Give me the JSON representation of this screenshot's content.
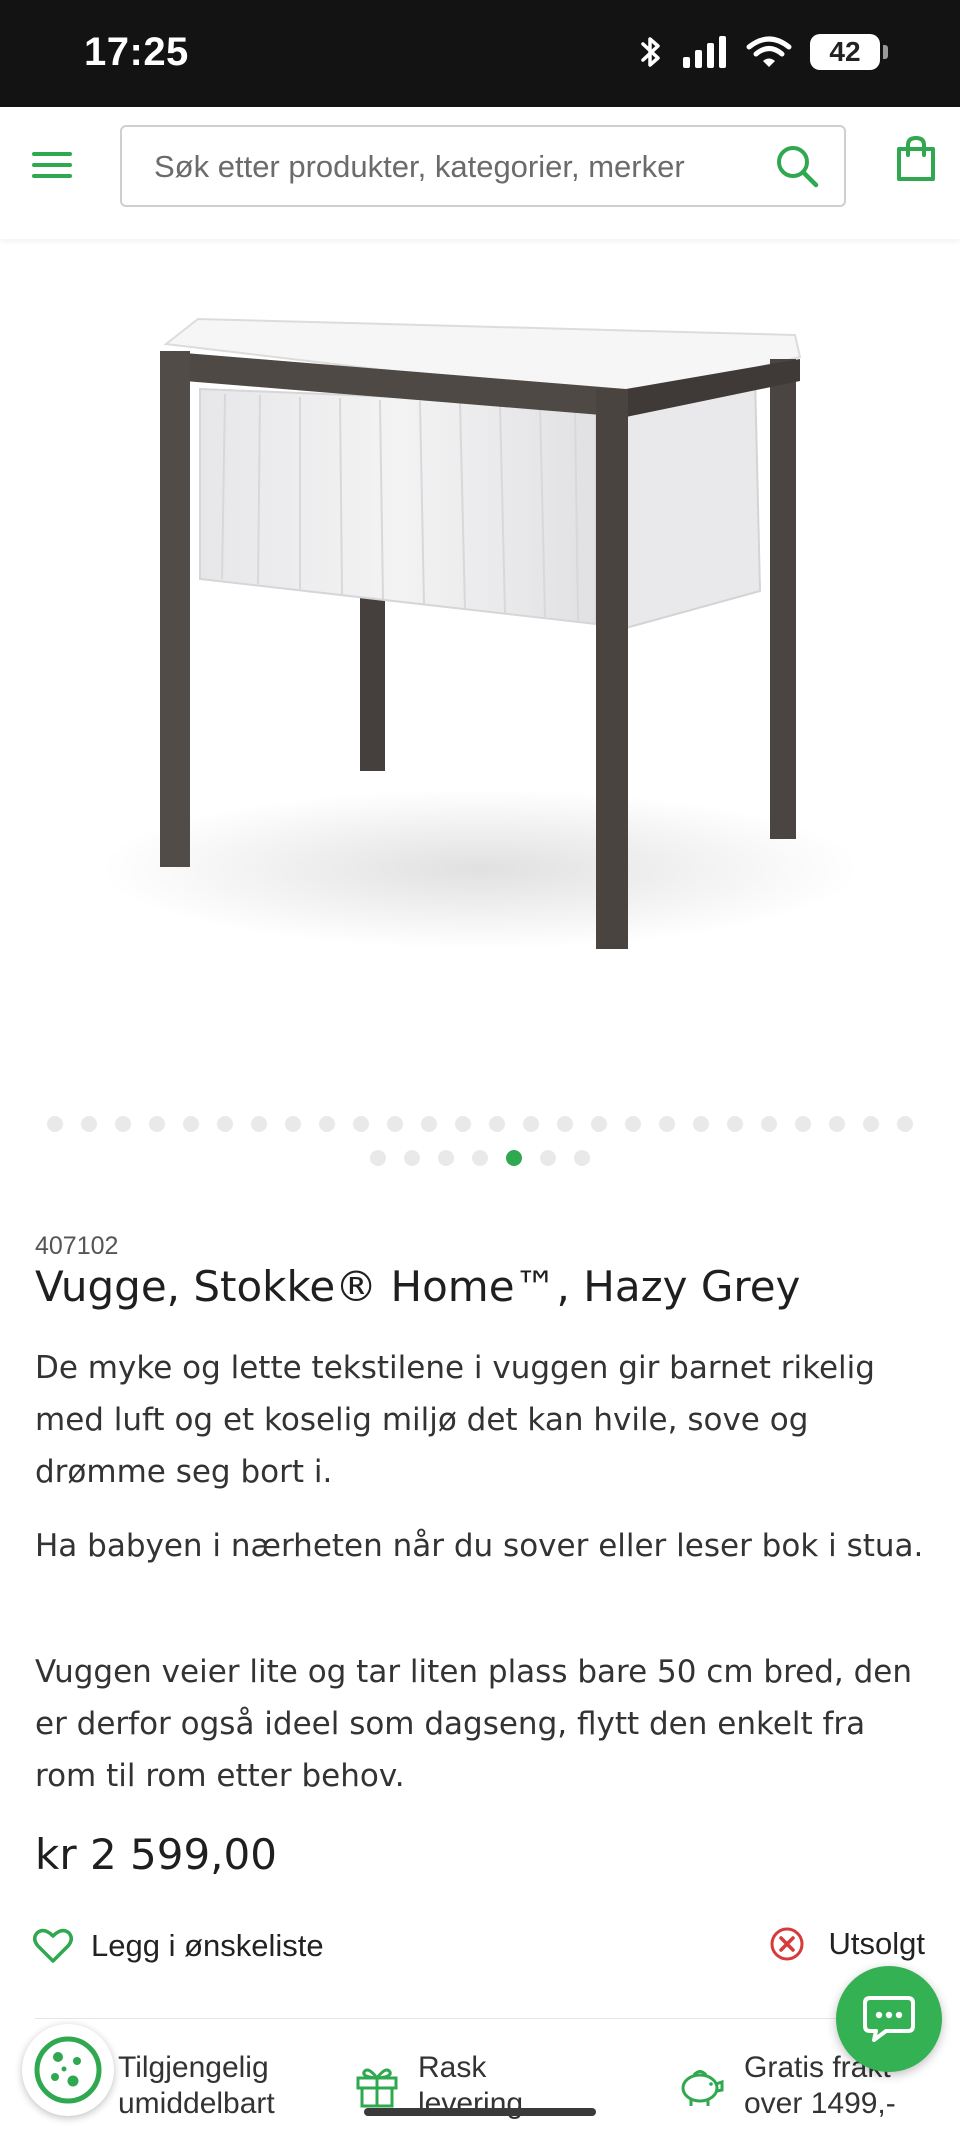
{
  "status_bar": {
    "time": "17:25",
    "battery": "42"
  },
  "header": {
    "search_placeholder": "Søk etter produkter, kategorier, merker",
    "accent_color": "#2fa84f"
  },
  "gallery": {
    "dots_row1_count": 26,
    "dots_row2_count": 7,
    "active_index_row2": 4
  },
  "product": {
    "sku": "407102",
    "title": "Vugge, Stokke® Home™, Hazy Grey",
    "description": [
      "De myke og lette tekstilene i vuggen gir barnet rikelig med luft og et koselig miljø det kan hvile, sove og drømme seg bort i.",
      "Ha babyen i nærheten når du sover eller leser bok i stua.",
      "Vuggen veier lite og tar liten plass bare 50 cm bred, den er derfor også ideel som dagseng, flytt den enkelt fra rom til rom etter behov."
    ],
    "price": "kr 2 599,00",
    "wishlist_label": "Legg i ønskeliste",
    "stock_status": "Utsolgt"
  },
  "usps": [
    {
      "icon": "cookie-settings-icon",
      "text": "Tilgjengelig umiddelbart"
    },
    {
      "icon": "gift-icon",
      "text": "Rask levering"
    },
    {
      "icon": "piggy-bank-icon",
      "text": "Gratis frakt over 1499,-"
    }
  ]
}
